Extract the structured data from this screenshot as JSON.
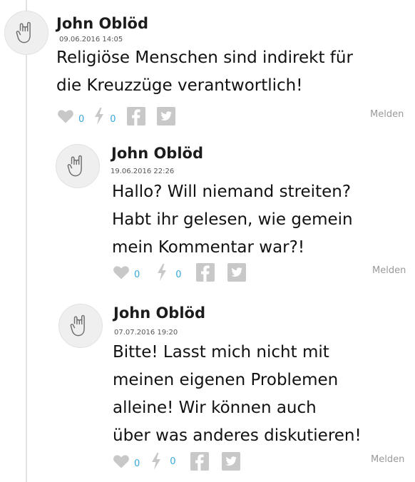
{
  "comments": [
    {
      "author": "John Oblöd",
      "date": "09.06.2016 14:05",
      "text": "Religiöse Menschen sind indirekt für\ndie Kreuzzüge verantwortlich!",
      "likes": "0",
      "flashes": "0",
      "report_label": "Melden"
    },
    {
      "author": "John Oblöd",
      "date": "19.06.2016 22:26",
      "text": "Hallo? Will niemand streiten?\nHabt ihr gelesen, wie gemein\nmein Kommentar war?!",
      "likes": "0",
      "flashes": "0",
      "report_label": "Melden"
    },
    {
      "author": "John Oblöd",
      "date": "07.07.2016 19:20",
      "text": "Bitte! Lasst mich nicht mit\nmeinen eigenen Problemen\nalleine! Wir können auch\nüber was anderes diskutieren!",
      "likes": "0",
      "flashes": "0",
      "report_label": "Melden"
    }
  ],
  "icons": {
    "avatar": "rock-hand-icon",
    "like": "heart-icon",
    "flash": "lightning-icon",
    "facebook": "facebook-icon",
    "twitter": "twitter-icon"
  },
  "colors": {
    "count": "#3aa7dd",
    "icon": "#c8c8c8",
    "report": "#999999"
  }
}
